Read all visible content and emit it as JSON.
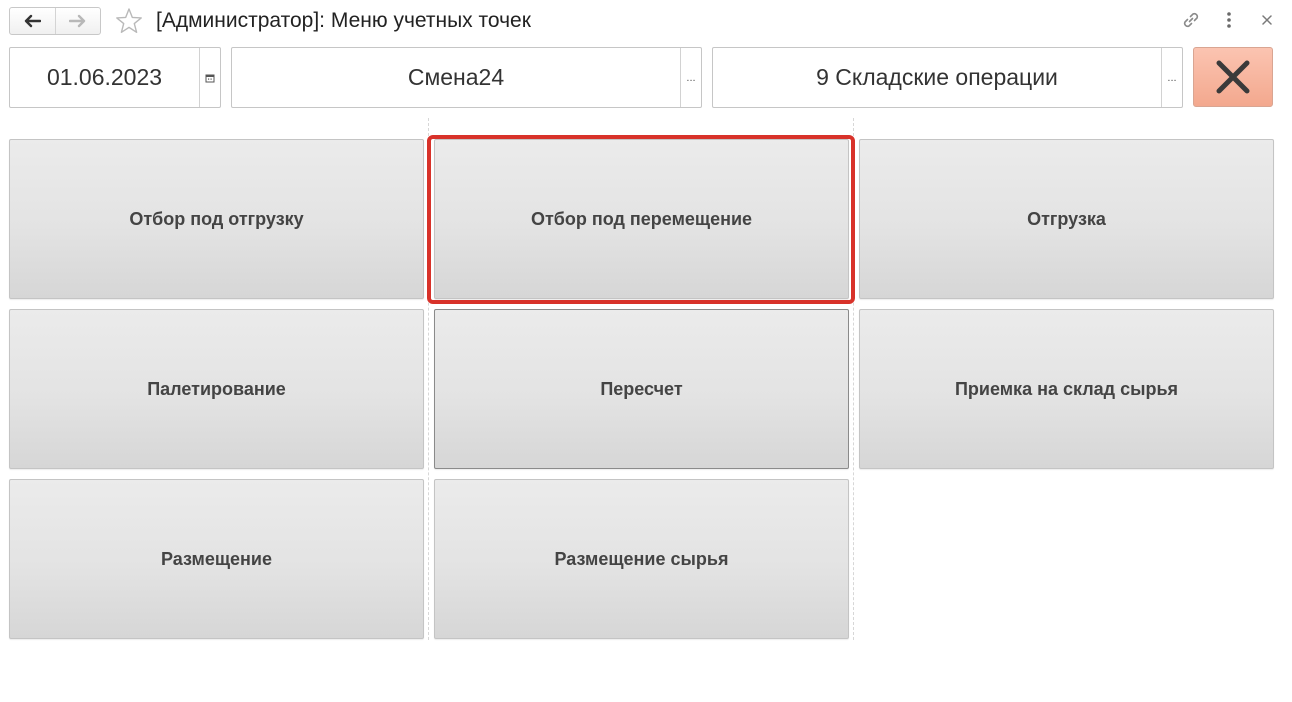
{
  "window": {
    "title": "[Администратор]: Меню учетных точек"
  },
  "toolbar": {
    "back_icon": "arrow-left-icon",
    "forward_icon": "arrow-right-icon",
    "favorite_icon": "star-icon",
    "link_icon": "link-icon",
    "more_icon": "more-vertical-icon",
    "close_icon": "close-icon"
  },
  "header": {
    "date": {
      "value": "01.06.2023",
      "button_icon": "calendar-icon"
    },
    "shift": {
      "value": "Смена24",
      "button_label": "..."
    },
    "accounting_point": {
      "value": "9 Складские операции",
      "button_label": "..."
    },
    "exit_icon": "close-x-icon"
  },
  "menu": {
    "tiles": [
      {
        "label": "Отбор под отгрузку"
      },
      {
        "label": "Отбор под перемещение",
        "focused": true
      },
      {
        "label": "Отгрузка"
      },
      {
        "label": "Палетирование"
      },
      {
        "label": "Пересчет"
      },
      {
        "label": "Приемка на склад сырья"
      },
      {
        "label": "Размещение"
      },
      {
        "label": "Размещение сырья"
      }
    ]
  },
  "colors": {
    "focus_ring": "#d8322a",
    "exit_button": "#f3a88e",
    "tile_background": "#e3e3e3"
  }
}
